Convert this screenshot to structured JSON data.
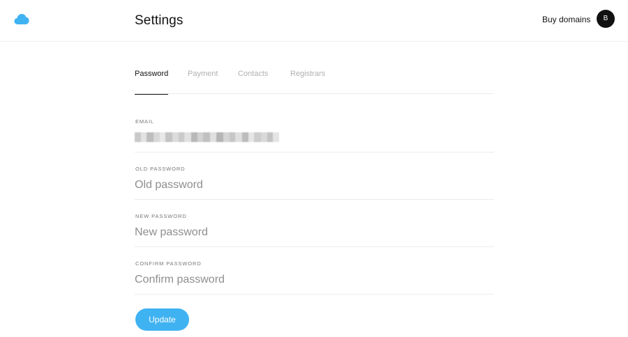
{
  "header": {
    "title": "Settings",
    "buy_domains_label": "Buy domains",
    "avatar_initial": "B",
    "logo_icon": "cloud-icon",
    "brand_color": "#3fb2f2"
  },
  "tabs": [
    {
      "label": "Password",
      "active": true
    },
    {
      "label": "Payment",
      "active": false
    },
    {
      "label": "Contacts",
      "active": false
    },
    {
      "label": "Registrars",
      "active": false
    }
  ],
  "form": {
    "email": {
      "label": "EMAIL"
    },
    "old_password": {
      "label": "OLD PASSWORD",
      "placeholder": "Old password"
    },
    "new_password": {
      "label": "NEW PASSWORD",
      "placeholder": "New password"
    },
    "confirm_password": {
      "label": "CONFIRM PASSWORD",
      "placeholder": "Confirm password"
    },
    "submit_label": "Update"
  }
}
